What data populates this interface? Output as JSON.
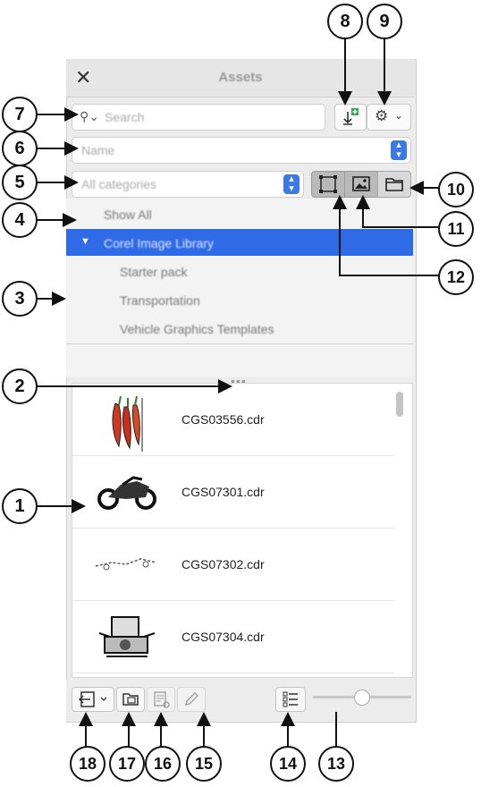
{
  "panel": {
    "title": "Assets",
    "close_icon": "close-icon",
    "search": {
      "placeholder": "Search"
    },
    "sort_value": "Name",
    "category_value": "All categories",
    "tree": {
      "show_all": "Show All",
      "library": "Corel Image Library",
      "children": [
        "Starter pack",
        "Transportation",
        "Vehicle Graphics Templates"
      ]
    },
    "files": [
      "CGS03556.cdr",
      "CGS07301.cdr",
      "CGS07302.cdr",
      "CGS07304.cdr"
    ]
  },
  "callouts": [
    "1",
    "2",
    "3",
    "4",
    "5",
    "6",
    "7",
    "8",
    "9",
    "10",
    "11",
    "12",
    "13",
    "14",
    "15",
    "16",
    "17",
    "18"
  ],
  "colors": {
    "accent": "#2f6be6",
    "add_green": "#2fa84f"
  }
}
